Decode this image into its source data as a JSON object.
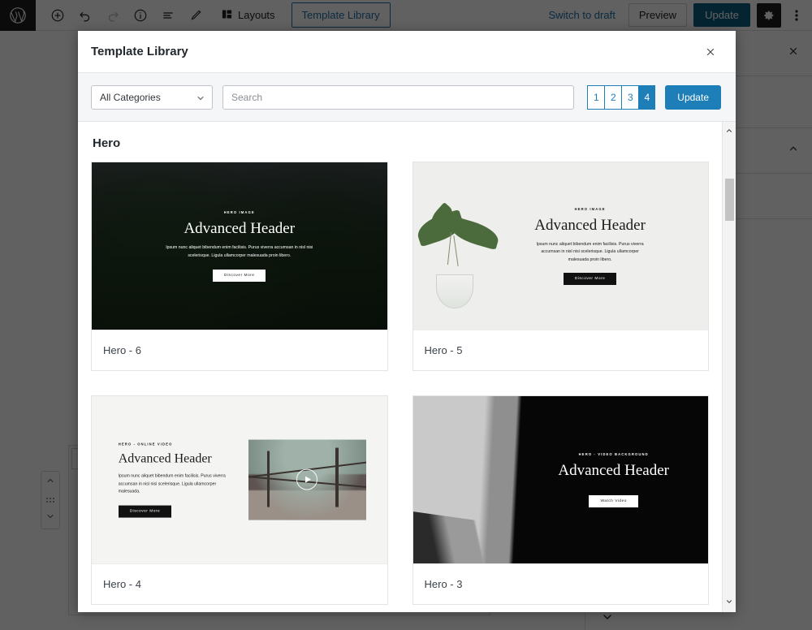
{
  "editor": {
    "toolbar": {
      "logo_icon": "wordpress-logo-icon",
      "add_block_label": "+",
      "icons": [
        "add-block-icon",
        "undo-icon",
        "redo-icon",
        "info-icon",
        "list-view-icon",
        "edit-icon"
      ],
      "layouts_label": "Layouts",
      "template_library_label": "Template Library",
      "switch_to_draft_label": "Switch to draft",
      "preview_label": "Preview",
      "update_label": "Update",
      "settings_icon": "gear-icon",
      "more_icon": "kebab-menu-icon"
    },
    "sidebar": {
      "close_icon": "close-icon",
      "collapse_icon": "chevron-up-icon"
    },
    "block_mover": {
      "up_icon": "chevron-up-icon",
      "drag_icon": "drag-handle-icon",
      "down_icon": "chevron-down-icon"
    },
    "bottom_chevron_icon": "chevron-down-icon"
  },
  "modal": {
    "title": "Template Library",
    "close_icon": "close-icon",
    "toolbar": {
      "category_value": "All Categories",
      "category_options": [
        "All Categories"
      ],
      "category_chevron_icon": "chevron-down-icon",
      "search_placeholder": "Search",
      "search_value": "",
      "pages": [
        "1",
        "2",
        "3",
        "4"
      ],
      "active_page": "4",
      "update_label": "Update"
    },
    "section_title": "Hero",
    "accent_color": "#1d7eb8",
    "cards": [
      {
        "name": "Hero - 6",
        "eyebrow": "HERO IMAGE",
        "heading": "Advanced Header",
        "body": "Ipsum nunc aliquet bibendum enim facilisis. Purus viverra accumsan in nisl nisi scelerisque. Ligula ullamcorper malesuada proin libero.",
        "button": "Discover More",
        "theme": "dark-photo"
      },
      {
        "name": "Hero - 5",
        "eyebrow": "HERO IMAGE",
        "heading": "Advanced Header",
        "body": "Ipsum nunc aliquet bibendum enim facilisis. Purus viverra accumsan in nisl nisi scelerisque. Ligula ullamcorper malesuada proin libero.",
        "button": "Discover More",
        "theme": "light-photo"
      },
      {
        "name": "Hero - 4",
        "eyebrow": "HERO - ONLINE VIDEO",
        "heading": "Advanced Header",
        "body": "Ipsum nunc aliquet bibendum enim facilisis. Purus viverra accumsan in nisl nisi scelerisque. Ligula ullamcorper malesuada.",
        "button": "Discover More",
        "theme": "light-split-video",
        "play_icon": "play-button-icon"
      },
      {
        "name": "Hero - 3",
        "eyebrow": "HERO - VIDEO BACKGROUND",
        "heading": "Advanced Header",
        "body": "",
        "button": "Watch Video",
        "theme": "black-brush"
      }
    ],
    "scrollbar": {
      "up_icon": "scroll-up-arrow-icon",
      "down_icon": "scroll-down-arrow-icon",
      "thumb": "scrollbar-thumb"
    }
  }
}
